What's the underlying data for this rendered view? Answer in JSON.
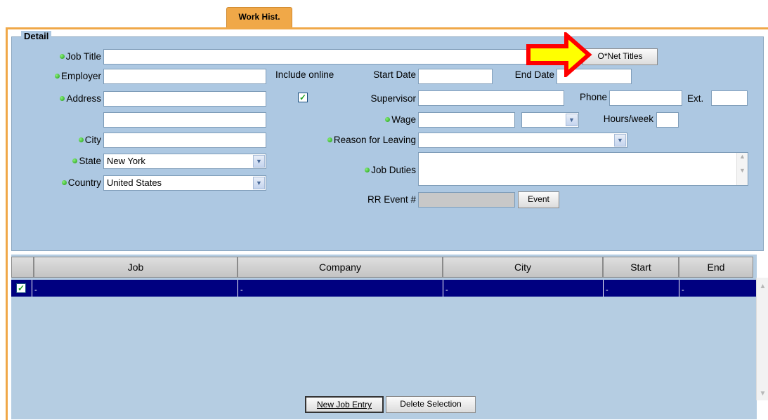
{
  "tab": {
    "label": "Work Hist."
  },
  "detail": {
    "legend": "Detail",
    "job_title_label": "Job Title",
    "job_title_value": "",
    "onet_button": "O*Net Titles",
    "employer_label": "Employer",
    "address_label": "Address",
    "city_label": "City",
    "state_label": "State",
    "state_value": "New York",
    "country_label": "Country",
    "country_value": "United States",
    "include_online_label": "Include online",
    "include_online_checked": true,
    "start_date_label": "Start Date",
    "end_date_label": "End Date",
    "supervisor_label": "Supervisor",
    "phone_label": "Phone",
    "ext_label": "Ext.",
    "wage_label": "Wage",
    "hours_label": "Hours/week",
    "reason_label": "Reason for Leaving",
    "duties_label": "Job Duties",
    "rr_event_label": "RR Event #",
    "event_button": "Event"
  },
  "grid": {
    "columns": [
      "Job",
      "Company",
      "City",
      "Start",
      "End"
    ],
    "rows": [
      {
        "selected": true,
        "cells": [
          "-",
          "-",
          "-",
          "-",
          "-"
        ]
      }
    ]
  },
  "actions": {
    "new_entry": "New Job Entry",
    "delete": "Delete Selection"
  },
  "colors": {
    "tab": "#f0a848",
    "panel": "#adc8e2",
    "grid_selection": "#000080",
    "required_dot": "#2bbd21",
    "arrow_fill": "#ffff00",
    "arrow_stroke": "#ff0000"
  },
  "icons": {
    "required": "green-dot-icon",
    "dropdown": "chevron-down-icon",
    "checkbox": "checkmark-icon",
    "annotation": "right-arrow-icon"
  }
}
